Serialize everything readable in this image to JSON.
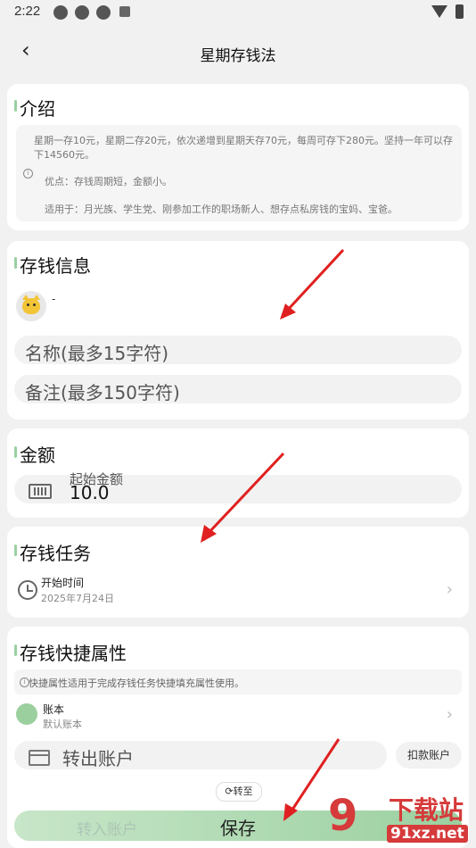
{
  "status_bar": {
    "time": "2:22"
  },
  "header": {
    "back_label": "‹",
    "title": "星期存钱法"
  },
  "intro": {
    "title": "介绍",
    "desc": "星期一存10元，星期二存20元，依次递增到星期天存70元，每周可存下280元。坚持一年可以存下14560元。",
    "pros": "优点：存钱周期短，金额小。",
    "apply": "适用于：月光族、学生党、刚参加工作的职场新人、想存点私房钱的宝妈、宝爸。"
  },
  "saving_info": {
    "title": "存钱信息",
    "avatar_dot": "-",
    "name_placeholder": "名称(最多15字符)",
    "note_placeholder": "备注(最多150字符)"
  },
  "amount": {
    "title": "金额",
    "label": "起始金额",
    "value": "10.0"
  },
  "task": {
    "title": "存钱任务",
    "start_label": "开始时间",
    "start_date": "2025年7月24日"
  },
  "shortcut": {
    "title": "存钱快捷属性",
    "tip": "快捷属性适用于完成存钱任务快捷填充属性使用。",
    "account_label": "账本",
    "account_value": "默认账本",
    "out_account": "转出账户",
    "deduct_button": "扣款账户",
    "transfer_chip": "转至",
    "in_account": "转入账户"
  },
  "save_button": "保存",
  "watermark": {
    "text": "下载站",
    "url": "91xz.net",
    "mark": "9"
  },
  "icons": [
    "back-icon",
    "info-icon",
    "cat-avatar-icon",
    "money-icon",
    "clock-icon",
    "chevron-right-icon",
    "account-icon",
    "card-icon",
    "transfer-icon"
  ],
  "colors": {
    "accent": "#9bd0a0",
    "arrow": "#e02020",
    "watermark": "#d63a3a"
  }
}
